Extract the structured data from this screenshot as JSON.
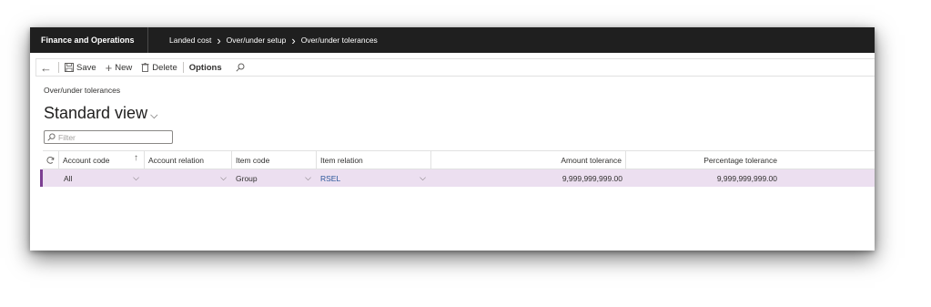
{
  "navbar": {
    "app_name": "Finance and Operations",
    "breadcrumbs": [
      "Landed cost",
      "Over/under setup",
      "Over/under tolerances"
    ]
  },
  "actions": {
    "save": "Save",
    "new": "New",
    "delete": "Delete",
    "options": "Options"
  },
  "page": {
    "caption": "Over/under tolerances",
    "view_name": "Standard view",
    "filter_placeholder": "Filter"
  },
  "grid": {
    "columns": {
      "account_code": "Account code",
      "account_relation": "Account relation",
      "item_code": "Item code",
      "item_relation": "Item relation",
      "amount_tolerance": "Amount tolerance",
      "percentage_tolerance": "Percentage tolerance"
    },
    "rows": [
      {
        "account_code": "All",
        "account_relation": "",
        "item_code": "Group",
        "item_relation": "RSEL",
        "amount_tolerance": "9,999,999,999.00",
        "percentage_tolerance": "9,999,999,999.00"
      }
    ]
  },
  "colors": {
    "navbar_bg": "#1f1f1f",
    "selected_row_bg": "#ecdff0",
    "selected_row_accent": "#7c3f92",
    "link": "#2b579a"
  }
}
